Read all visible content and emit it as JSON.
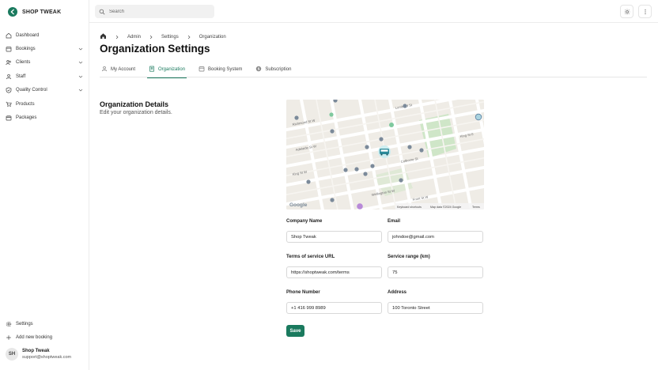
{
  "brand": {
    "name": "SHOP TWEAK"
  },
  "colors": {
    "accent": "#1a7a5e",
    "map_bg": "#efece6",
    "map_road": "#ffffff",
    "map_park": "#cfe6c8",
    "map_water": "#aad3df",
    "map_pin": "#7b8a9a"
  },
  "sidebar": {
    "items": [
      {
        "label": "Dashboard",
        "icon": "home-icon",
        "expandable": false
      },
      {
        "label": "Bookings",
        "icon": "calendar-icon",
        "expandable": true
      },
      {
        "label": "Clients",
        "icon": "users-icon",
        "expandable": true
      },
      {
        "label": "Staff",
        "icon": "user-icon",
        "expandable": true
      },
      {
        "label": "Quality Control",
        "icon": "shield-check-icon",
        "expandable": true
      },
      {
        "label": "Products",
        "icon": "cart-icon",
        "expandable": false
      },
      {
        "label": "Packages",
        "icon": "package-icon",
        "expandable": false
      }
    ],
    "bottom_items": [
      {
        "label": "Settings",
        "icon": "gear-icon"
      },
      {
        "label": "Add new booking",
        "icon": "plus-icon"
      }
    ],
    "user": {
      "initials": "SH",
      "name": "Shop Tweak",
      "email": "support@shoptweak.com"
    }
  },
  "search": {
    "placeholder": "Search"
  },
  "breadcrumb": {
    "items": [
      "Admin",
      "Settings",
      "Organization"
    ]
  },
  "page": {
    "title": "Organization Settings"
  },
  "tabs": [
    {
      "label": "My Account",
      "icon": "user-icon",
      "active": false
    },
    {
      "label": "Organization",
      "icon": "building-icon",
      "active": true
    },
    {
      "label": "Booking System",
      "icon": "calendar-icon",
      "active": false
    },
    {
      "label": "Subscription",
      "icon": "dollar-icon",
      "active": false
    }
  ],
  "section": {
    "title": "Organization Details",
    "subtitle": "Edit your organization details."
  },
  "map": {
    "attribution": {
      "logo": "Google",
      "shortcuts": "Keyboard shortcuts",
      "data": "Map data ©2024 Google",
      "terms": "Terms"
    },
    "streets": [
      "Richmond St W",
      "Adelaide St W",
      "King St W",
      "Wellington St W",
      "Lombard St",
      "Colborne St",
      "King St E",
      "Front St W"
    ]
  },
  "form": {
    "company_name": {
      "label": "Company Name",
      "value": "Shop Tweak"
    },
    "email": {
      "label": "Email",
      "value": "johndoe@gmail.com"
    },
    "terms_url": {
      "label": "Terms of service URL",
      "value": "https://shoptweak.com/terms"
    },
    "service_range": {
      "label": "Service range (km)",
      "value": "75"
    },
    "phone": {
      "label": "Phone Number",
      "value": "+1 416 999 8989"
    },
    "address": {
      "label": "Address",
      "value": "100 Toronto Street"
    },
    "save_label": "Save"
  }
}
